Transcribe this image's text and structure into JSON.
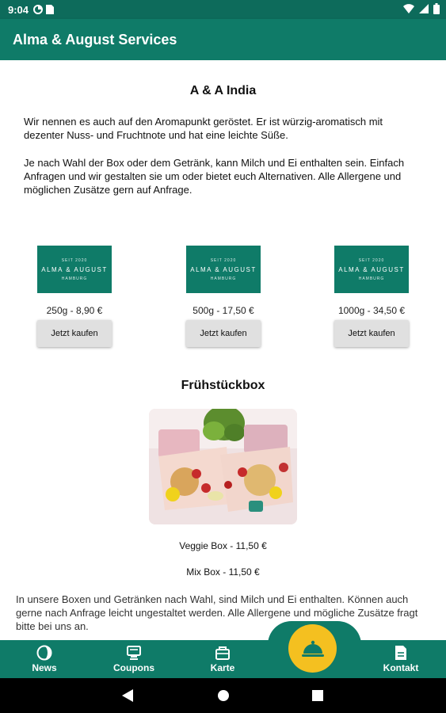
{
  "status_bar": {
    "time": "9:04"
  },
  "app_bar": {
    "title": "Alma & August Services"
  },
  "product_section": {
    "title": "A & A India",
    "description_1": "Wir nennen es auch auf den Aromapunkt geröstet. Er ist würzig-aromatisch mit dezenter Nuss- und Fruchtnote und hat eine leichte Süße.",
    "description_2": "Je nach Wahl der Box oder dem Getränk, kann Milch und Ei enthalten sein. Einfach Anfragen und wir gestalten sie um oder bietet euch Alternativen. Alle Allergene und möglichen Zusätze gern auf Anfrage.",
    "products": [
      {
        "price": "250g - 8,90 €",
        "button": "Jetzt kaufen"
      },
      {
        "price": "500g - 17,50 €",
        "button": "Jetzt kaufen"
      },
      {
        "price": "1000g - 34,50 €",
        "button": "Jetzt kaufen"
      }
    ],
    "logo": {
      "top": "SEIT 2020",
      "main": "ALMA & AUGUST",
      "bottom": "HAMBURG"
    }
  },
  "breakfast": {
    "title": "Frühstückbox",
    "options": [
      "Veggie Box - 11,50 €",
      "Mix Box - 11,50 €"
    ],
    "note": "In unsere Boxen und Getränken nach Wahl, sind Milch und Ei enthalten. Können auch gerne nach Anfrage leicht ungestaltet werden. Alle Allergene und mögliche Zusätze fragt bitte bei uns an."
  },
  "bottom_nav": {
    "items": [
      {
        "label": "News",
        "icon": "news-icon"
      },
      {
        "label": "Coupons",
        "icon": "coupon-icon"
      },
      {
        "label": "Karte",
        "icon": "menu-card-icon"
      },
      {
        "label": "Kontakt",
        "icon": "contact-icon"
      }
    ],
    "fab_icon": "cloche-icon"
  },
  "colors": {
    "primary": "#0f7b68",
    "status": "#0d6b5b",
    "fab": "#f4c020"
  }
}
